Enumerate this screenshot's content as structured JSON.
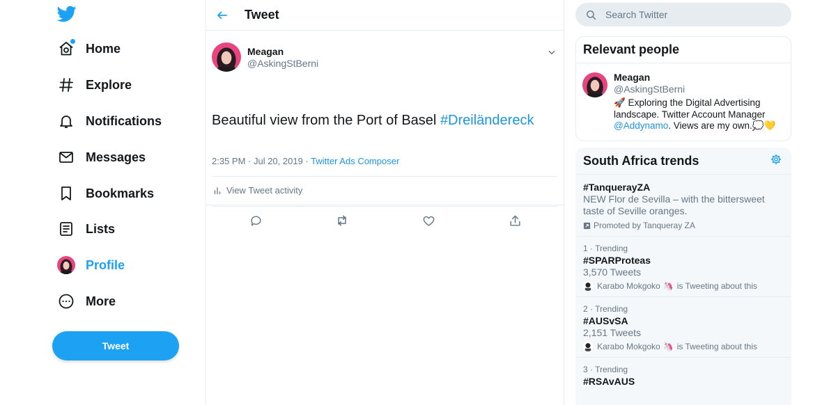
{
  "nav": {
    "items": [
      {
        "label": "Home",
        "icon": "home-icon"
      },
      {
        "label": "Explore",
        "icon": "hashtag-icon"
      },
      {
        "label": "Notifications",
        "icon": "bell-icon"
      },
      {
        "label": "Messages",
        "icon": "envelope-icon"
      },
      {
        "label": "Bookmarks",
        "icon": "bookmark-icon"
      },
      {
        "label": "Lists",
        "icon": "list-icon"
      },
      {
        "label": "Profile",
        "icon": "avatar"
      },
      {
        "label": "More",
        "icon": "more-icon"
      }
    ],
    "tweet_button": "Tweet",
    "accent_color": "#1da1f2"
  },
  "header": {
    "title": "Tweet"
  },
  "tweet": {
    "author_name": "Meagan",
    "author_handle": "@AskingStBerni",
    "text": "Beautiful view from the Port of Basel ",
    "hashtag": "#Dreiländereck",
    "time_date": "2:35 PM · Jul 20, 2019 · ",
    "source": "Twitter Ads Composer",
    "activity_label": "View Tweet activity"
  },
  "search": {
    "placeholder": "Search Twitter"
  },
  "relevant_people": {
    "title": "Relevant people",
    "person": {
      "name": "Meagan",
      "handle": "@AskingStBerni",
      "bio_prefix": "🚀 Exploring the Digital Advertising landscape. Twitter Account Manager ",
      "bio_mention": "@Addynamo",
      "bio_suffix": ". Views are my own.💭💛"
    }
  },
  "trends": {
    "title": "South Africa trends",
    "promoted": {
      "name": "#TanquerayZA",
      "description": "NEW Flor de Sevilla – with the bittersweet taste of Seville oranges.",
      "promoted_by": "Promoted by Tanqueray ZA"
    },
    "items": [
      {
        "context": "1 · Trending",
        "name": "#SPARProteas",
        "count": "3,570 Tweets",
        "social_user": "Karabo Mokgoko",
        "social_suffix": "is Tweeting about this"
      },
      {
        "context": "2 · Trending",
        "name": "#AUSvSA",
        "count": "2,151 Tweets",
        "social_user": "Karabo Mokgoko",
        "social_suffix": "is Tweeting about this"
      },
      {
        "context": "3 · Trending",
        "name": "#RSAvAUS",
        "count": "",
        "social_user": "",
        "social_suffix": ""
      }
    ]
  }
}
